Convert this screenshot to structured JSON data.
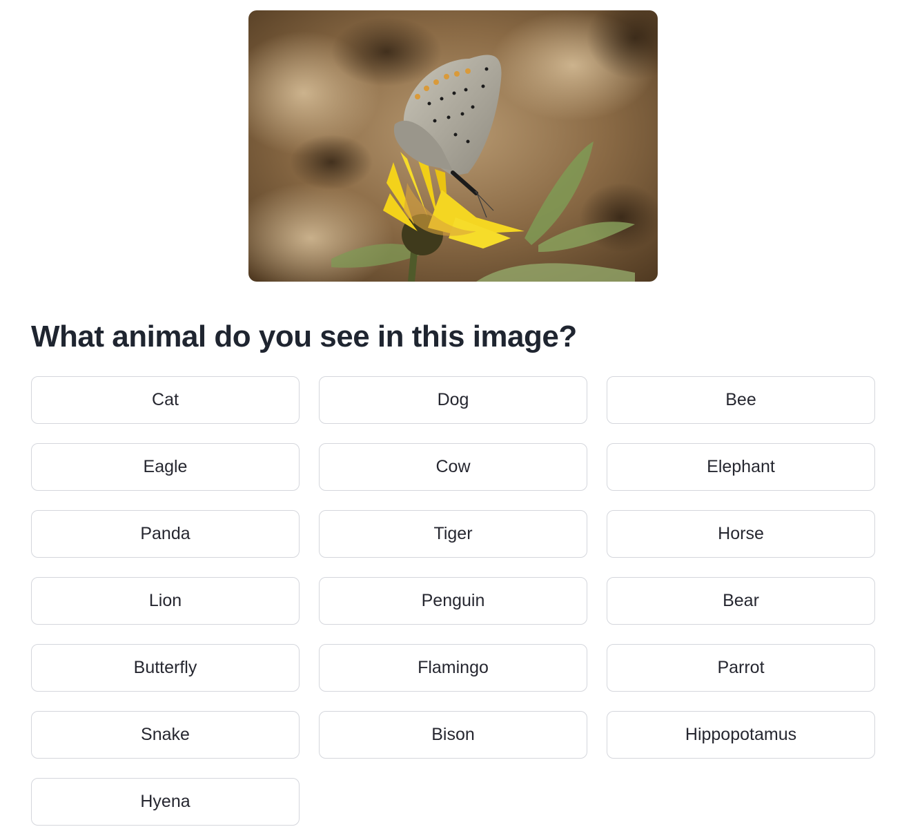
{
  "image": {
    "subject": "butterfly-on-yellow-flower"
  },
  "question": "What animal do you see in this image?",
  "options": [
    "Cat",
    "Dog",
    "Bee",
    "Eagle",
    "Cow",
    "Elephant",
    "Panda",
    "Tiger",
    "Horse",
    "Lion",
    "Penguin",
    "Bear",
    "Butterfly",
    "Flamingo",
    "Parrot",
    "Snake",
    "Bison",
    "Hippopotamus",
    "Hyena"
  ],
  "colors": {
    "button_border": "#d4d6dc",
    "question_text": "#1f2530",
    "flower_yellow": "#f3d21b"
  }
}
